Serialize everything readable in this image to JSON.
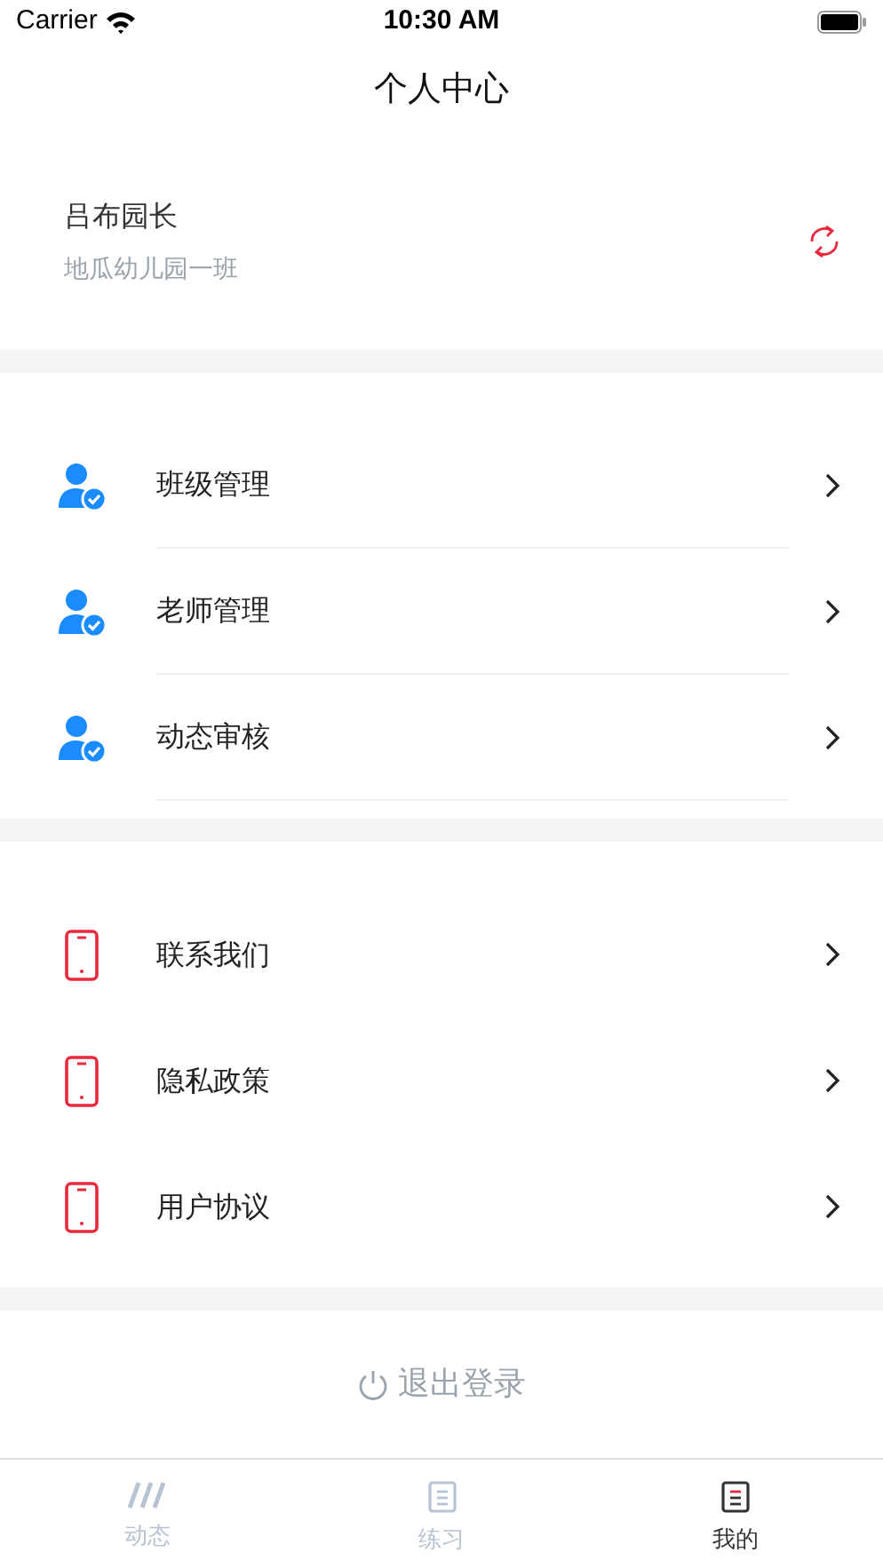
{
  "status_bar": {
    "carrier": "Carrier",
    "time": "10:30 AM"
  },
  "nav": {
    "title": "个人中心"
  },
  "profile": {
    "name": "吕布园长",
    "class": "地瓜幼儿园一班"
  },
  "menu_groups": [
    {
      "items": [
        {
          "kind": "person",
          "label": "班级管理"
        },
        {
          "kind": "person",
          "label": "老师管理"
        },
        {
          "kind": "person",
          "label": "动态审核"
        }
      ]
    },
    {
      "items": [
        {
          "kind": "phone",
          "label": "联系我们"
        },
        {
          "kind": "phone",
          "label": "隐私政策"
        },
        {
          "kind": "phone",
          "label": "用户协议"
        }
      ]
    }
  ],
  "logout": {
    "label": "退出登录"
  },
  "tab_bar": [
    {
      "kind": "feed",
      "label": "动态",
      "selected": false
    },
    {
      "kind": "practice",
      "label": "练习",
      "selected": false
    },
    {
      "kind": "mine",
      "label": "我的",
      "selected": true
    }
  ]
}
